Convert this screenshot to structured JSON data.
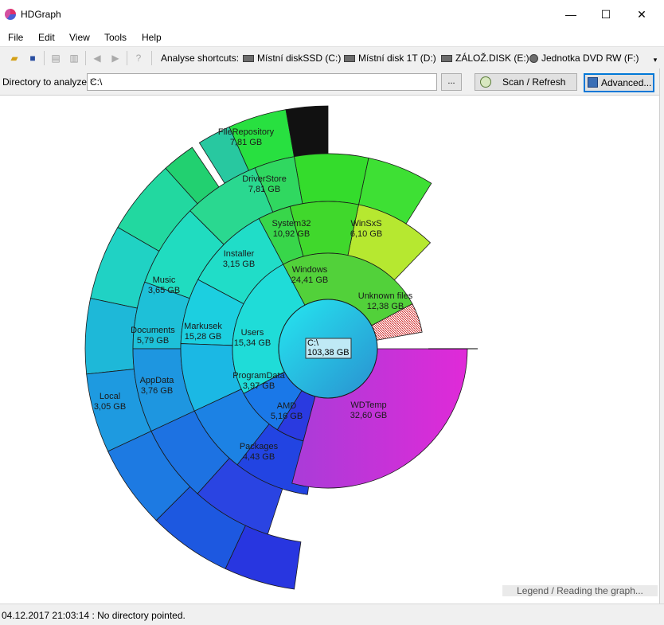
{
  "window": {
    "title": "HDGraph",
    "minimize": "—",
    "maximize": "☐",
    "close": "✕"
  },
  "menu": [
    "File",
    "Edit",
    "View",
    "Tools",
    "Help"
  ],
  "toolbar": {
    "shortcuts_label": "Analyse shortcuts:",
    "drives": [
      "Místní diskSSD (C:)",
      "Místní disk 1T (D:)",
      "ZÁLOŽ.DISK (E:)",
      "Jednotka DVD RW (F:)"
    ]
  },
  "directory": {
    "label": "Directory to analyze :",
    "value": "C:\\",
    "browse_label": "...",
    "scan_label": "Scan / Refresh",
    "advanced_label": "Advanced..."
  },
  "graph": {
    "root": {
      "name": "C:\\",
      "size": "103,38 GB"
    },
    "labels": [
      {
        "name": "FileRepository",
        "size": "7,81 GB"
      },
      {
        "name": "DriverStore",
        "size": "7,81 GB"
      },
      {
        "name": "System32",
        "size": "10,92 GB"
      },
      {
        "name": "WinSxS",
        "size": "6,10 GB"
      },
      {
        "name": "Installer",
        "size": "3,15 GB"
      },
      {
        "name": "Windows",
        "size": "24,41 GB"
      },
      {
        "name": "Unknown files",
        "size": "12,38 GB"
      },
      {
        "name": "Music",
        "size": "3,65 GB"
      },
      {
        "name": "Documents",
        "size": "5,79 GB"
      },
      {
        "name": "Markusek",
        "size": "15,28 GB"
      },
      {
        "name": "Users",
        "size": "15,34 GB"
      },
      {
        "name": "AppData",
        "size": "3,76 GB"
      },
      {
        "name": "ProgramData",
        "size": "3,97 GB"
      },
      {
        "name": "Local",
        "size": "3,05 GB"
      },
      {
        "name": "AMD",
        "size": "5,16 GB"
      },
      {
        "name": "WDTemp",
        "size": "32,60 GB"
      },
      {
        "name": "Packages",
        "size": "4,43 GB"
      }
    ],
    "legend_link": "Legend / Reading the graph..."
  },
  "status": {
    "text": "04.12.2017 21:03:14 : No directory pointed."
  },
  "colors": {
    "windows": "#52d13a",
    "system32": "#3ad032",
    "users": "#1fdcd8",
    "programdata": "#1a78e8",
    "amd": "#2a3ae0",
    "wdtemp": "#c836d6",
    "unknown": "#d02b2b",
    "root": "#2bbfe0"
  }
}
